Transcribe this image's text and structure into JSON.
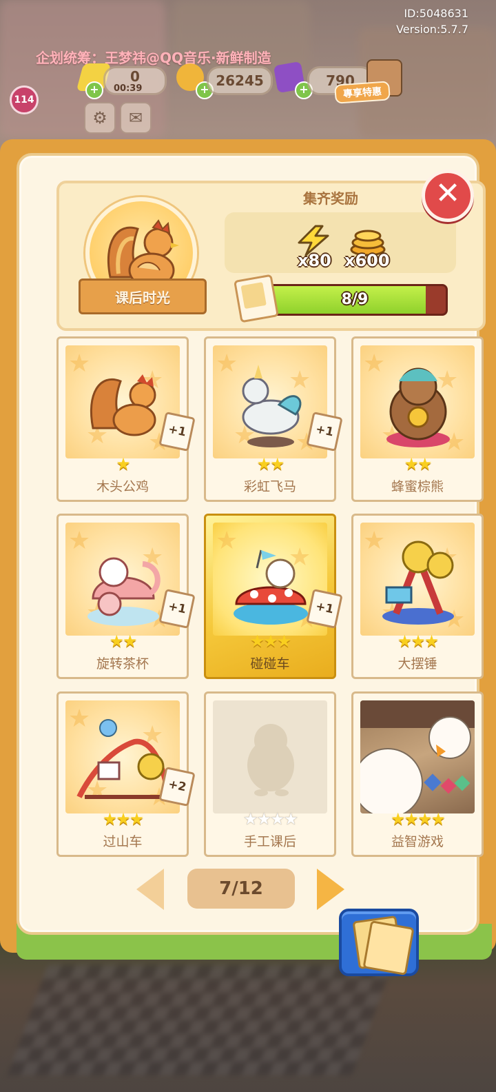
{
  "hud": {
    "build_id": "ID:5048631",
    "version": "Version:5.7.7",
    "credit": "企划统筹：王梦祎@QQ音乐·新鲜制造",
    "level": "114",
    "energy": "0",
    "energy_timer": "00:39",
    "coins": "26245",
    "gems": "790",
    "sale_label": "專享特惠"
  },
  "album": {
    "title": "课后时光",
    "reward_title": "集齐奖励",
    "rewards": [
      {
        "icon": "lightning-icon",
        "amount": "x80"
      },
      {
        "icon": "coin-stack-icon",
        "amount": "x600"
      }
    ],
    "progress_text": "8/9",
    "progress_fraction": 0.889
  },
  "cards": [
    {
      "name": "木头公鸡",
      "stars": 1,
      "max_stars": 1,
      "bonus": "+1",
      "state": "owned"
    },
    {
      "name": "彩虹飞马",
      "stars": 2,
      "max_stars": 2,
      "bonus": "+1",
      "state": "owned"
    },
    {
      "name": "蜂蜜棕熊",
      "stars": 2,
      "max_stars": 2,
      "bonus": "",
      "state": "owned"
    },
    {
      "name": "旋转茶杯",
      "stars": 2,
      "max_stars": 2,
      "bonus": "+1",
      "state": "owned"
    },
    {
      "name": "碰碰车",
      "stars": 3,
      "max_stars": 3,
      "bonus": "+1",
      "state": "selected"
    },
    {
      "name": "大摆锤",
      "stars": 3,
      "max_stars": 3,
      "bonus": "",
      "state": "owned"
    },
    {
      "name": "过山车",
      "stars": 3,
      "max_stars": 3,
      "bonus": "+2",
      "state": "owned"
    },
    {
      "name": "手工课后",
      "stars": 0,
      "max_stars": 4,
      "bonus": "",
      "state": "locked"
    },
    {
      "name": "益智游戏",
      "stars": 4,
      "max_stars": 4,
      "bonus": "",
      "state": "photo"
    }
  ],
  "pagination": {
    "label": "7/12"
  },
  "colors": {
    "accent": "#e2a03e",
    "progress": "#a8e03a",
    "close": "#e14a4a",
    "star": "#f9cf1f"
  }
}
